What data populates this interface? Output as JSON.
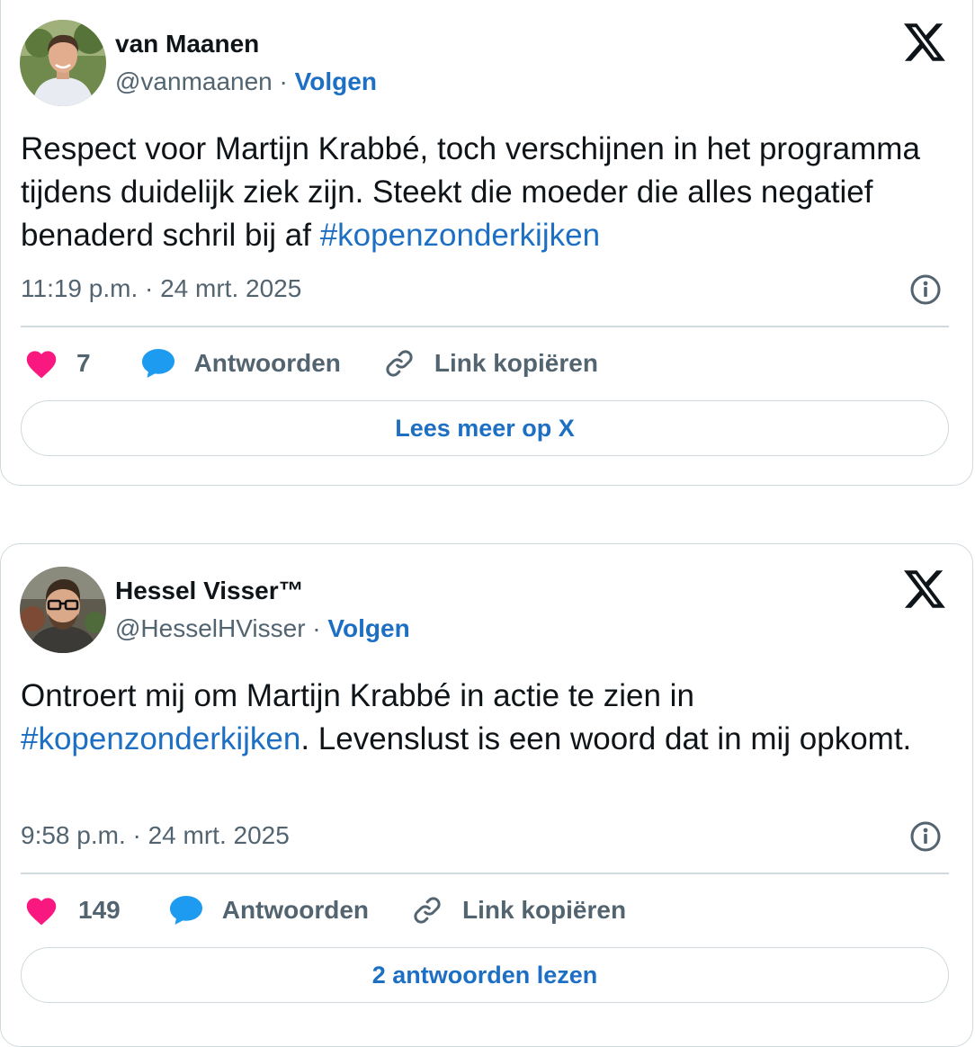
{
  "tweets": [
    {
      "display_name": "van Maanen",
      "handle": "@vanmaanen",
      "separator": " · ",
      "follow_label": "Volgen",
      "text_before": "Respect voor Martijn Krabbé, toch verschijnen in het programma tijdens duidelijk ziek zijn. Steekt die moeder die alles negatief benaderd schril bij af ",
      "hashtag": "#kopenzonderkijken",
      "text_after": "",
      "timestamp": "11:19 p.m. · 24 mrt. 2025",
      "like_count": "7",
      "reply_label": "Antwoorden",
      "copy_link_label": "Link kopiëren",
      "footer_button_label": "Lees meer op X"
    },
    {
      "display_name": "Hessel Visser™",
      "handle": "@HesselHVisser",
      "separator": " · ",
      "follow_label": "Volgen",
      "text_before": "Ontroert mij om Martijn Krabbé in actie te zien in ",
      "hashtag": "#kopenzonderkijken",
      "text_after": ". Levenslust is een woord dat in mij opkomt.",
      "timestamp": "9:58 p.m. · 24 mrt. 2025",
      "like_count": "149",
      "reply_label": "Antwoorden",
      "copy_link_label": "Link kopiëren",
      "footer_button_label": "2 antwoorden lezen"
    }
  ],
  "colors": {
    "accent_blue": "#1d6fc4",
    "like_pink": "#f91880",
    "reply_blue": "#1d9bf0",
    "secondary_text": "#536471",
    "border": "#cfd9de"
  },
  "icons": {
    "platform_logo": "x-logo-icon",
    "info": "info-icon",
    "like": "heart-icon",
    "reply": "speech-bubble-icon",
    "copy_link": "link-icon"
  }
}
